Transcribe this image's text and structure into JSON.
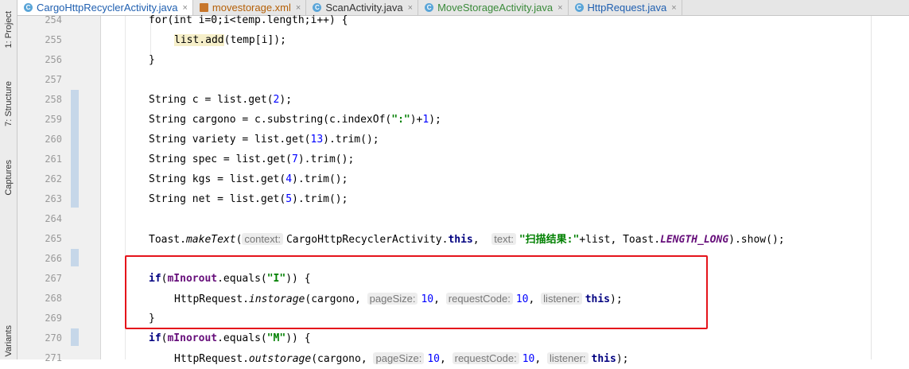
{
  "sidebar": {
    "tabs": [
      {
        "label": "1: Project",
        "icon": "project-icon"
      },
      {
        "label": "7: Structure",
        "icon": "structure-icon"
      },
      {
        "label": "Captures",
        "icon": "captures-icon"
      },
      {
        "label": "Variants",
        "icon": ""
      }
    ]
  },
  "editor_tabs": [
    {
      "label": "CargoHttpRecyclerActivity.java",
      "icon": "java-class-icon",
      "active": true
    },
    {
      "label": "movestorage.xml",
      "icon": "xml-file-icon",
      "active": false
    },
    {
      "label": "ScanActivity.java",
      "icon": "java-class-icon",
      "active": false
    },
    {
      "label": "MoveStorageActivity.java",
      "icon": "java-class-icon",
      "active": false
    },
    {
      "label": "HttpRequest.java",
      "icon": "java-class-icon",
      "active": false
    }
  ],
  "close_glyph": "×",
  "lines": [
    {
      "no": "254",
      "pre": "for(int i=0;i<temp.length;i++) {"
    },
    {
      "no": "255",
      "list_add": "list.add",
      "args": "(temp[i]);"
    },
    {
      "no": "256",
      "text": "}"
    },
    {
      "no": "257",
      "text": ""
    },
    {
      "no": "258",
      "a": "String c = list.get(",
      "n": "2",
      "b": ");"
    },
    {
      "no": "259",
      "a": "String cargono = c.substring(c.indexOf(",
      "s": "\":\"",
      "b": ")+",
      "n": "1",
      "c": ");"
    },
    {
      "no": "260",
      "a": "String variety = list.get(",
      "n": "13",
      "b": ").trim();"
    },
    {
      "no": "261",
      "a": "String spec = list.get(",
      "n": "7",
      "b": ").trim();"
    },
    {
      "no": "262",
      "a": "String kgs = list.get(",
      "n": "4",
      "b": ").trim();"
    },
    {
      "no": "263",
      "a": "String net = list.get(",
      "n": "5",
      "b": ").trim();"
    },
    {
      "no": "264",
      "text": ""
    },
    {
      "no": "265",
      "a": "Toast.",
      "m": "makeText",
      "b": "(",
      "h1": "context:",
      "c": "CargoHttpRecyclerActivity.",
      "k": "this",
      "d": ",",
      "h2": "text:",
      "s": "\"扫描结果:\"",
      "e": "+list, Toast.",
      "f": "LENGTH_LONG",
      "g": ").show();"
    },
    {
      "no": "266",
      "text": ""
    },
    {
      "no": "267",
      "k": "if",
      "b": "(",
      "f": "mInorout",
      "c": ".equals(",
      "s": "\"I\"",
      "d": ")) {"
    },
    {
      "no": "268",
      "a": "HttpRequest.",
      "m": "instorage",
      "b": "(cargono,",
      "h1": "pageSize:",
      "n1": "10",
      "c": ",",
      "h2": "requestCode:",
      "n2": "10",
      "d": ",",
      "h3": "listener:",
      "k": "this",
      "e": ");"
    },
    {
      "no": "269",
      "text": "}"
    },
    {
      "no": "270",
      "k": "if",
      "b": "(",
      "f": "mInorout",
      "c": ".equals(",
      "s": "\"M\"",
      "d": ")) {"
    },
    {
      "no": "271",
      "a": "HttpRequest.",
      "m": "outstorage",
      "b": "(cargono,",
      "h1": "pageSize:",
      "n1": "10",
      "c": ",",
      "h2": "requestCode:",
      "n2": "10",
      "d": ",",
      "h3": "listener:",
      "k": "this",
      "e": ");"
    }
  ]
}
